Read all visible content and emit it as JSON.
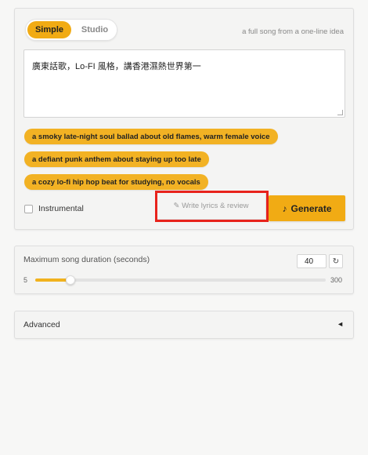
{
  "mode_toggle": {
    "simple_label": "Simple",
    "studio_label": "Studio"
  },
  "tagline": "a full song from a one-line idea",
  "prompt": {
    "value": "廣東話歌，Lo-FI 風格，講香港濕熱世界第一"
  },
  "suggestions": [
    {
      "label": "a smoky late-night soul ballad about old flames, warm female voice"
    },
    {
      "label": "a defiant punk anthem about staying up too late"
    },
    {
      "label": "a cozy lo-fi hip hop beat for studying, no vocals"
    }
  ],
  "instrumental": {
    "label": "Instrumental",
    "checked": false
  },
  "write_lyrics": {
    "label": "✎ Write lyrics & review"
  },
  "generate": {
    "icon": "♪",
    "label": "Generate"
  },
  "duration": {
    "label": "Maximum song duration (seconds)",
    "value": "40",
    "reset_icon": "↻",
    "min": "5",
    "max": "300",
    "fraction": 0.12
  },
  "advanced": {
    "label": "Advanced",
    "caret": "◄"
  },
  "colors": {
    "accent": "#f1ab14",
    "highlight": "#e8231c"
  }
}
